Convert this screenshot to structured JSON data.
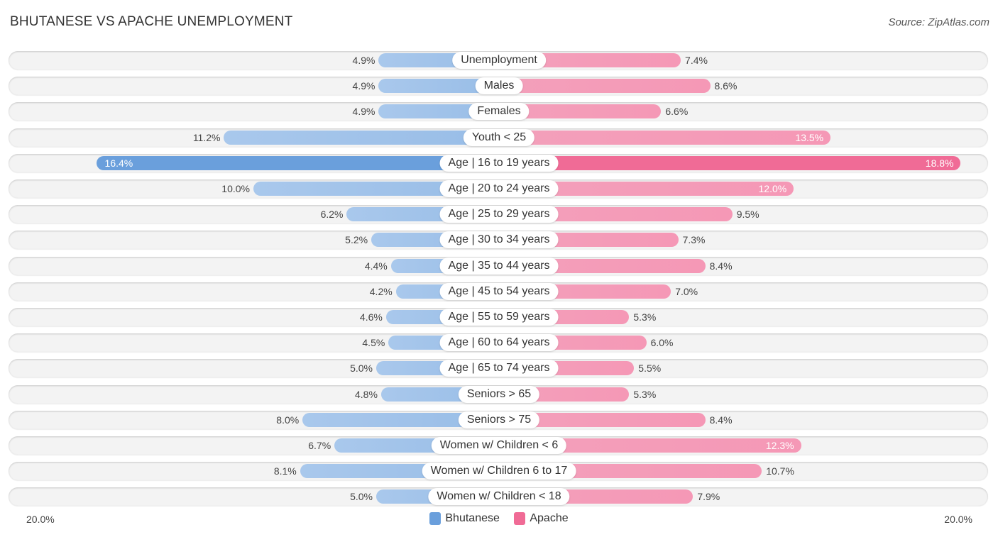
{
  "header": {
    "title": "BHUTANESE VS APACHE UNEMPLOYMENT",
    "source": "Source: ZipAtlas.com"
  },
  "colors": {
    "bhutanese": "#6a9fdc",
    "apache": "#f06b96"
  },
  "chart_data": {
    "type": "bar",
    "orientation": "horizontal-diverging",
    "title": "BHUTANESE VS APACHE UNEMPLOYMENT",
    "xlim": [
      -20,
      20
    ],
    "axis_labels": {
      "left": "20.0%",
      "right": "20.0%"
    },
    "legend": {
      "position": "bottom-center",
      "entries": [
        "Bhutanese",
        "Apache"
      ]
    },
    "categories": [
      "Unemployment",
      "Males",
      "Females",
      "Youth < 25",
      "Age | 16 to 19 years",
      "Age | 20 to 24 years",
      "Age | 25 to 29 years",
      "Age | 30 to 34 years",
      "Age | 35 to 44 years",
      "Age | 45 to 54 years",
      "Age | 55 to 59 years",
      "Age | 60 to 64 years",
      "Age | 65 to 74 years",
      "Seniors > 65",
      "Seniors > 75",
      "Women w/ Children < 6",
      "Women w/ Children 6 to 17",
      "Women w/ Children < 18"
    ],
    "series": [
      {
        "name": "Bhutanese",
        "values": [
          4.9,
          4.9,
          4.9,
          11.2,
          16.4,
          10.0,
          6.2,
          5.2,
          4.4,
          4.2,
          4.6,
          4.5,
          5.0,
          4.8,
          8.0,
          6.7,
          8.1,
          5.0
        ],
        "labels": [
          "4.9%",
          "4.9%",
          "4.9%",
          "11.2%",
          "16.4%",
          "10.0%",
          "6.2%",
          "5.2%",
          "4.4%",
          "4.2%",
          "4.6%",
          "4.5%",
          "5.0%",
          "4.8%",
          "8.0%",
          "6.7%",
          "8.1%",
          "5.0%"
        ]
      },
      {
        "name": "Apache",
        "values": [
          7.4,
          8.6,
          6.6,
          13.5,
          18.8,
          12.0,
          9.5,
          7.3,
          8.4,
          7.0,
          5.3,
          6.0,
          5.5,
          5.3,
          8.4,
          12.3,
          10.7,
          7.9
        ],
        "labels": [
          "7.4%",
          "8.6%",
          "6.6%",
          "13.5%",
          "18.8%",
          "12.0%",
          "9.5%",
          "7.3%",
          "8.4%",
          "7.0%",
          "5.3%",
          "6.0%",
          "5.5%",
          "5.3%",
          "8.4%",
          "12.3%",
          "10.7%",
          "7.9%"
        ]
      }
    ]
  }
}
